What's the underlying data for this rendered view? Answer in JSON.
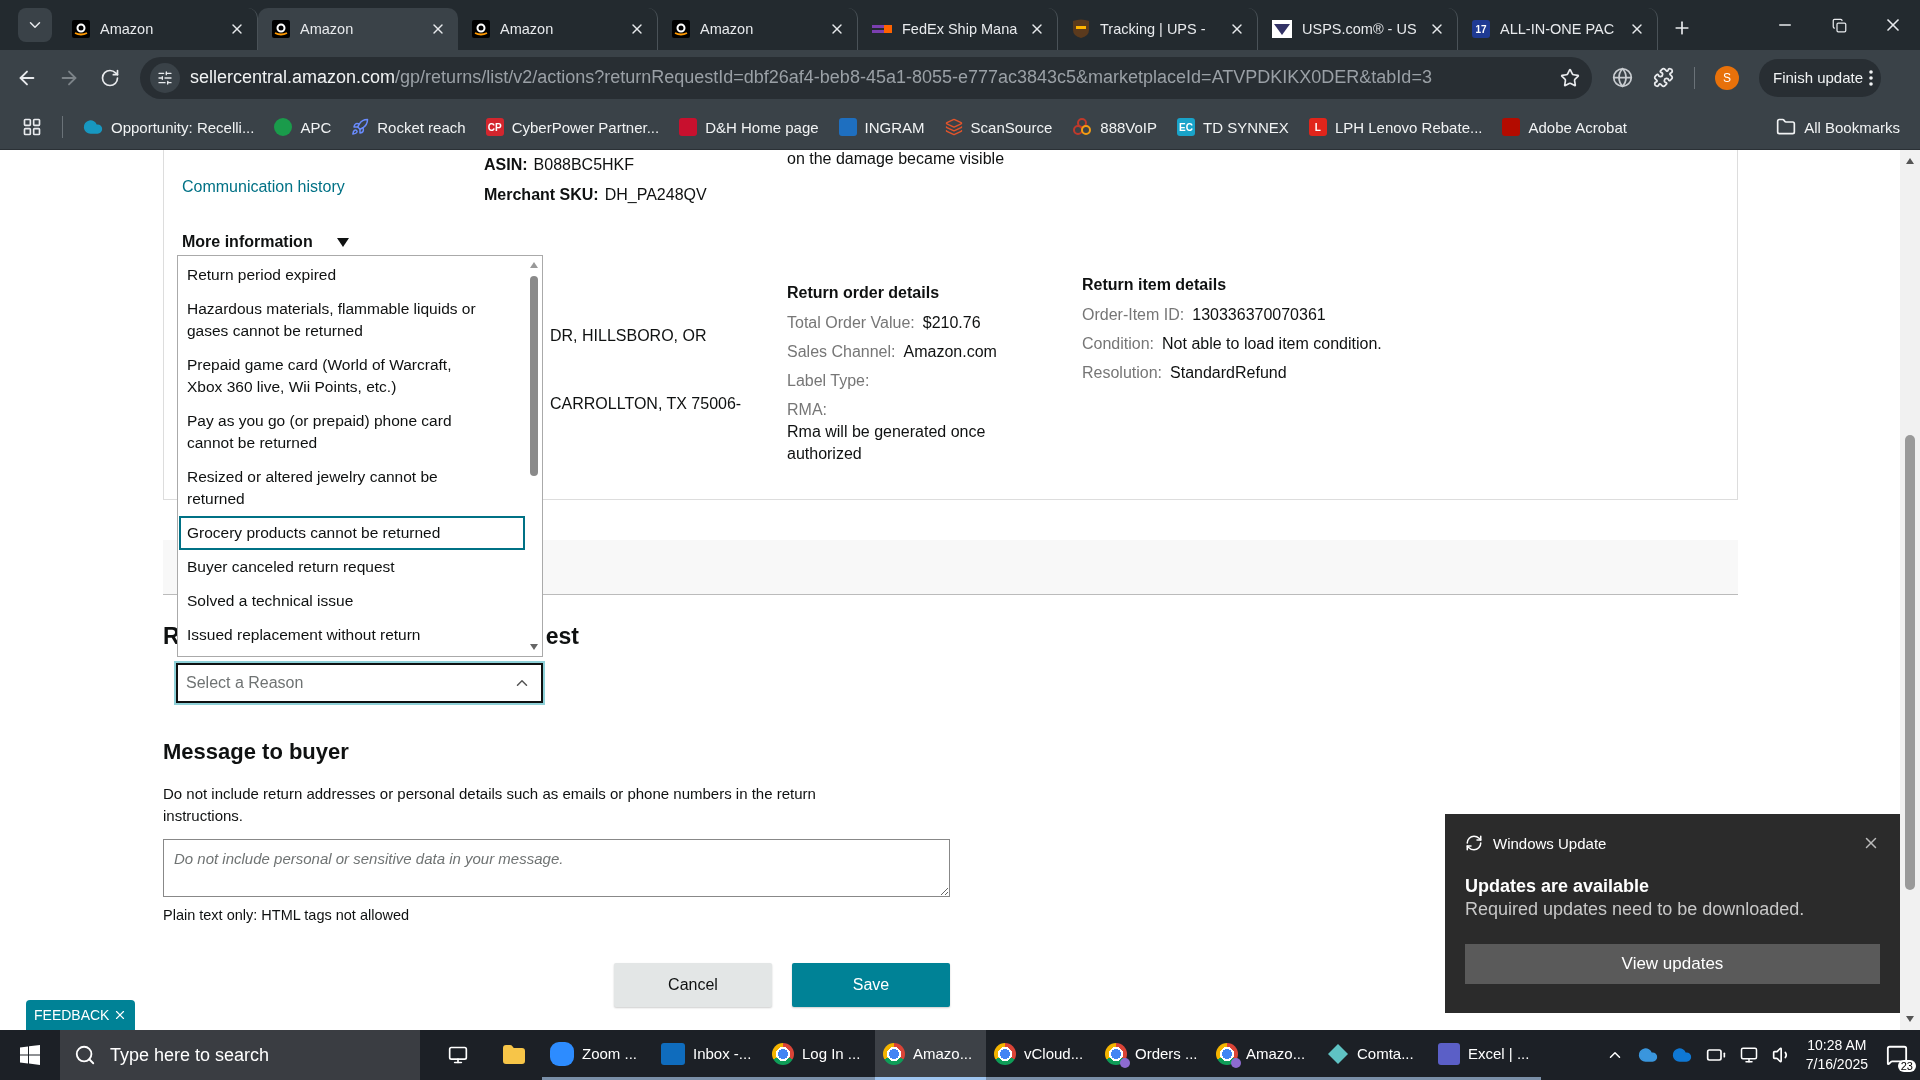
{
  "browser": {
    "tabs": [
      {
        "title": "Amazon",
        "selected": false
      },
      {
        "title": "Amazon",
        "selected": true
      },
      {
        "title": "Amazon",
        "selected": false
      },
      {
        "title": "Amazon",
        "selected": false
      },
      {
        "title": "FedEx Ship Mana",
        "selected": false
      },
      {
        "title": "Tracking | UPS -",
        "selected": false
      },
      {
        "title": "USPS.com® - US",
        "selected": false
      },
      {
        "title": "ALL-IN-ONE PAC",
        "icon_text": "17",
        "selected": false
      }
    ],
    "address": {
      "host": "sellercentral.amazon.com",
      "path": "/gp/returns/list/v2/actions?returnRequestId=dbf26af4-beb8-45a1-8055-e777ac3843c5&marketplaceId=ATVPDKIKX0DER&tabId=3"
    },
    "profile_initial": "S",
    "update_button": "Finish update",
    "bookmarks": [
      {
        "label": "Opportunity: Recelli..."
      },
      {
        "label": "APC"
      },
      {
        "label": "Rocket reach"
      },
      {
        "label": "CyberPower Partner...",
        "icon_text": "CP"
      },
      {
        "label": "D&H Home page"
      },
      {
        "label": "INGRAM"
      },
      {
        "label": "ScanSource"
      },
      {
        "label": "888VoIP"
      },
      {
        "label": "TD SYNNEX",
        "icon_text": "EC"
      },
      {
        "label": "LPH Lenovo Rebate...",
        "icon_text": "L"
      },
      {
        "label": "Adobe Acrobat"
      }
    ],
    "all_bookmarks": "All Bookmarks"
  },
  "details": {
    "communication_link": "Communication history",
    "more_information": "More information",
    "product": [
      {
        "label": "ASIN:",
        "value": "B088BC5HKF"
      },
      {
        "label": "Merchant SKU:",
        "value": "DH_PA248QV"
      }
    ],
    "damage_note": "on the damage became visible",
    "address_lines": [
      "DR, HILLSBORO, OR",
      "CARROLLTON, TX 75006-"
    ],
    "return_order": {
      "title": "Return order details",
      "fields": [
        {
          "label": "Total Order Value:",
          "value": "$210.76",
          "kind": "inline"
        },
        {
          "label": "Sales Channel:",
          "value": "Amazon.com",
          "kind": "inline"
        },
        {
          "label": "Label Type:",
          "kind": "inline"
        },
        {
          "label": "RMA:",
          "value": "Rma will be generated once authorized",
          "kind": "below"
        }
      ]
    },
    "return_item": {
      "title": "Return item details",
      "fields": [
        {
          "label": "Order-Item ID:",
          "value": "130336370070361",
          "kind": "inline"
        },
        {
          "label": "Condition:",
          "value": "Not able to load item condition.",
          "kind": "inline"
        },
        {
          "label": "Resolution:",
          "value": "StandardRefund",
          "kind": "inline"
        }
      ]
    }
  },
  "reject": {
    "heading_parts": [
      "R",
      "est"
    ],
    "select": {
      "placeholder": "Select a Reason",
      "expanded": true
    },
    "options": [
      {
        "label": "Return period expired",
        "selected": false
      },
      {
        "label": "Hazardous materials, flammable liquids or gases cannot be returned",
        "selected": false
      },
      {
        "label": "Prepaid game card (World of Warcraft, Xbox 360 live, Wii Points, etc.)",
        "selected": false
      },
      {
        "label": "Pay as you go (or prepaid) phone card cannot be returned",
        "selected": false
      },
      {
        "label": "Resized or altered jewelry cannot be returned",
        "selected": false
      },
      {
        "label": "Grocery products cannot be returned",
        "selected": true
      },
      {
        "label": "Buyer canceled return request",
        "selected": false
      },
      {
        "label": "Solved a technical issue",
        "selected": false
      },
      {
        "label": "Issued replacement without return",
        "selected": false
      }
    ]
  },
  "message": {
    "title": "Message to buyer",
    "hint": "Do not include return addresses or personal details such as emails or phone numbers in the return instructions.",
    "placeholder": "Do not include personal or sensitive data in your message.",
    "note": "Plain text only: HTML tags not allowed"
  },
  "actions": {
    "cancel": "Cancel",
    "save": "Save"
  },
  "feedback": "FEEDBACK",
  "toast": {
    "app": "Windows Update",
    "title": "Updates are available",
    "body": "Required updates need to be downloaded.",
    "button": "View updates"
  },
  "taskbar": {
    "search_placeholder": "Type here to search",
    "apps": [
      {
        "label": "Zoom ...",
        "selected": false
      },
      {
        "label": "Inbox -...",
        "selected": false
      },
      {
        "label": "Log In ...",
        "selected": false
      },
      {
        "label": "Amazo...",
        "selected": true
      },
      {
        "label": "vCloud...",
        "selected": false
      },
      {
        "label": "Orders ...",
        "selected": false
      },
      {
        "label": "Amazo...",
        "selected": false
      },
      {
        "label": "Comta...",
        "selected": false
      },
      {
        "label": "Excel | ...",
        "selected": false
      }
    ],
    "time": "10:28 AM",
    "date": "7/16/2025",
    "notification_count": "23"
  }
}
